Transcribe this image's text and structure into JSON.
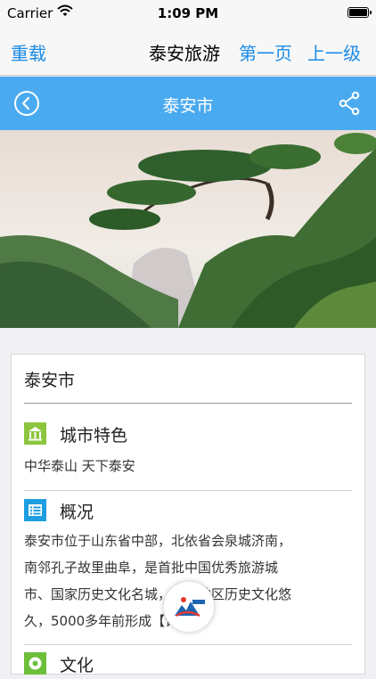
{
  "status_bar": {
    "carrier": "Carrier",
    "time": "1:09 PM"
  },
  "navbar": {
    "reload": "重载",
    "title": "泰安旅游",
    "first_page": "第一页",
    "up_level": "上一级"
  },
  "header": {
    "title": "泰安市"
  },
  "card": {
    "title": "泰安市",
    "sections": [
      {
        "heading": "城市特色",
        "icon": "building-icon",
        "color": "#8cc63f",
        "text": "中华泰山 天下泰安"
      },
      {
        "heading": "概况",
        "icon": "list-icon",
        "color": "#1e9ee0",
        "lines": [
          "泰安市位于山东省中部，北依省会泉城济南，",
          "南邻孔子故里曲阜，是首批中国优秀旅游城",
          "市、国家历史文化名城，泰安地区历史文化悠",
          "久，5000多年前形成【详细】"
        ]
      },
      {
        "heading": "文化",
        "icon": "leaf-icon",
        "color": "#6cbf3a"
      }
    ]
  },
  "colors": {
    "accent": "#1a8be8",
    "header_blue": "#4aaaf0"
  }
}
